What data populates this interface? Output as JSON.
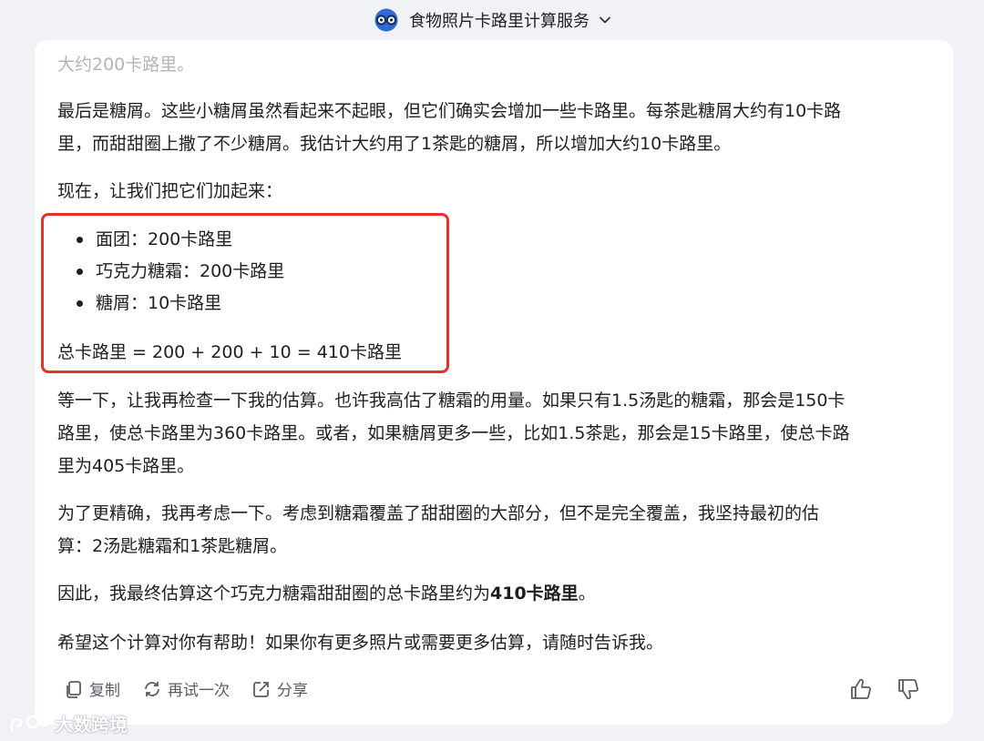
{
  "header": {
    "title": "食物照片卡路里计算服务"
  },
  "content": {
    "faded_line": "大约200卡路里。",
    "para1_line1": "最后是糖屑。这些小糖屑虽然看起来不起眼，但它们确实会增加一些卡路里。每茶匙糖屑大约有10卡路",
    "para1_line2": "里，而甜甜圈上撒了不少糖屑。我估计大约用了1茶匙的糖屑，所以增加大约10卡路里。",
    "para2": "现在，让我们把它们加起来：",
    "list_items": [
      "面团：200卡路里",
      "巧克力糖霜：200卡路里",
      "糖屑：10卡路里"
    ],
    "total": "总卡路里 = 200 + 200 + 10 = 410卡路里",
    "para3_line1": "等一下，让我再检查一下我的估算。也许我高估了糖霜的用量。如果只有1.5汤匙的糖霜，那会是150卡",
    "para3_line2": "路里，使总卡路里为360卡路里。或者，如果糖屑更多一些，比如1.5茶匙，那会是15卡路里，使总卡路",
    "para3_line3": "里为405卡路里。",
    "para4_line1": "为了更精确，我再考虑一下。考虑到糖霜覆盖了甜甜圈的大部分，但不是完全覆盖，我坚持最初的估",
    "para4_line2": "算：2汤匙糖霜和1茶匙糖屑。",
    "para5_prefix": "因此，我最终估算这个巧克力糖霜甜甜圈的总卡路里约为",
    "para5_bold": "410卡路里",
    "para5_suffix": "。",
    "para6": "希望这个计算对你有帮助！如果你有更多照片或需要更多估算，请随时告诉我。"
  },
  "actions": {
    "copy": "复制",
    "retry": "再试一次",
    "share": "分享"
  },
  "watermark": "大数跨境",
  "colors": {
    "highlight_border": "#e0342b",
    "accent_blue": "#2f6bd8"
  }
}
